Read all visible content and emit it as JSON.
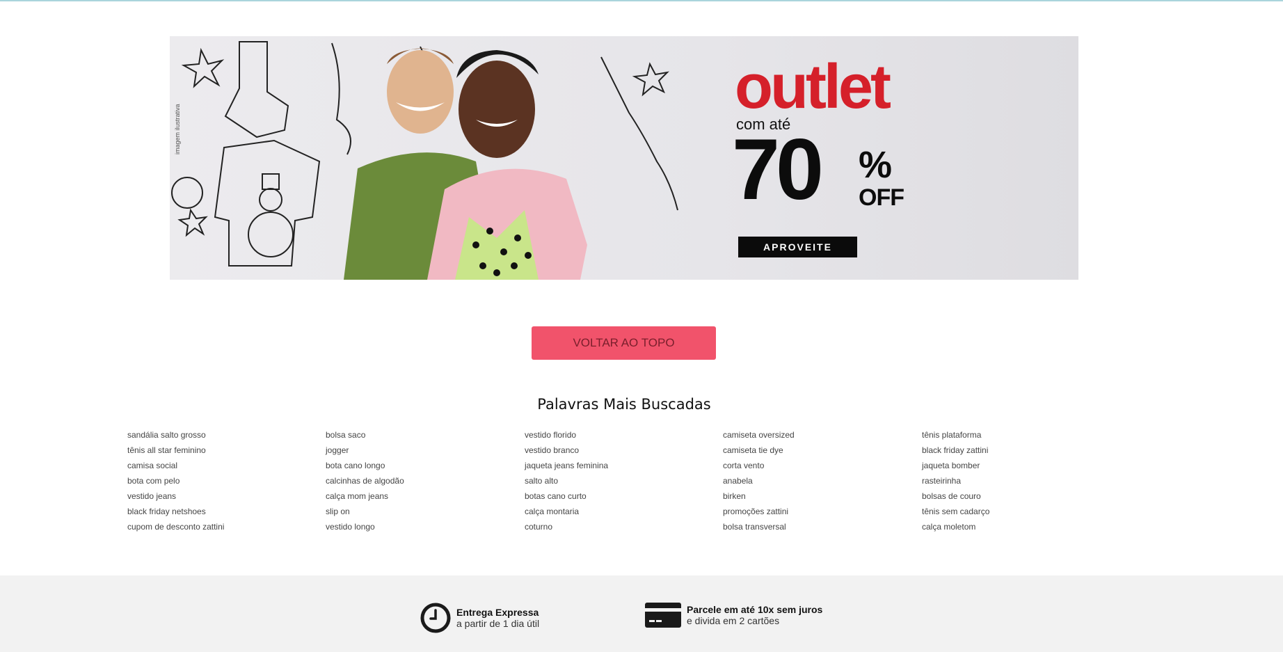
{
  "banner": {
    "illustration_note": "imagem ilustrativa",
    "headline": "outlet",
    "subhead": "com até",
    "discount_number": "70",
    "discount_percent": "%",
    "discount_off": "OFF",
    "cta_label": "APROVEITE",
    "brand_color": "#d5202a"
  },
  "back_to_top_label": "VOLTAR AO TOPO",
  "keywords": {
    "title": "Palavras Mais Buscadas",
    "columns": [
      [
        "sandália salto grosso",
        "tênis all star feminino",
        "camisa social",
        "bota com pelo",
        "vestido jeans",
        "black friday netshoes",
        "cupom de desconto zattini"
      ],
      [
        "bolsa saco",
        "jogger",
        "bota cano longo",
        "calcinhas de algodão",
        "calça mom jeans",
        "slip on",
        "vestido longo"
      ],
      [
        "vestido florido",
        "vestido branco",
        "jaqueta jeans feminina",
        "salto alto",
        "botas cano curto",
        "calça montaria",
        "coturno"
      ],
      [
        "camiseta oversized",
        "camiseta tie dye",
        "corta vento",
        "anabela",
        "birken",
        "promoções zattini",
        "bolsa transversal"
      ],
      [
        "tênis plataforma",
        "black friday zattini",
        "jaqueta bomber",
        "rasteirinha",
        "bolsas de couro",
        "tênis sem cadarço",
        "calça moletom"
      ]
    ]
  },
  "benefits": [
    {
      "icon": "clock-icon",
      "title": "Entrega Expressa",
      "subtitle": "a partir de 1 dia útil"
    },
    {
      "icon": "credit-card-icon",
      "title": "Parcele em até 10x sem juros",
      "subtitle": "e divida em 2 cartões"
    }
  ],
  "colors": {
    "button": "#f1536b",
    "footer_bg": "#f2f2f2"
  }
}
